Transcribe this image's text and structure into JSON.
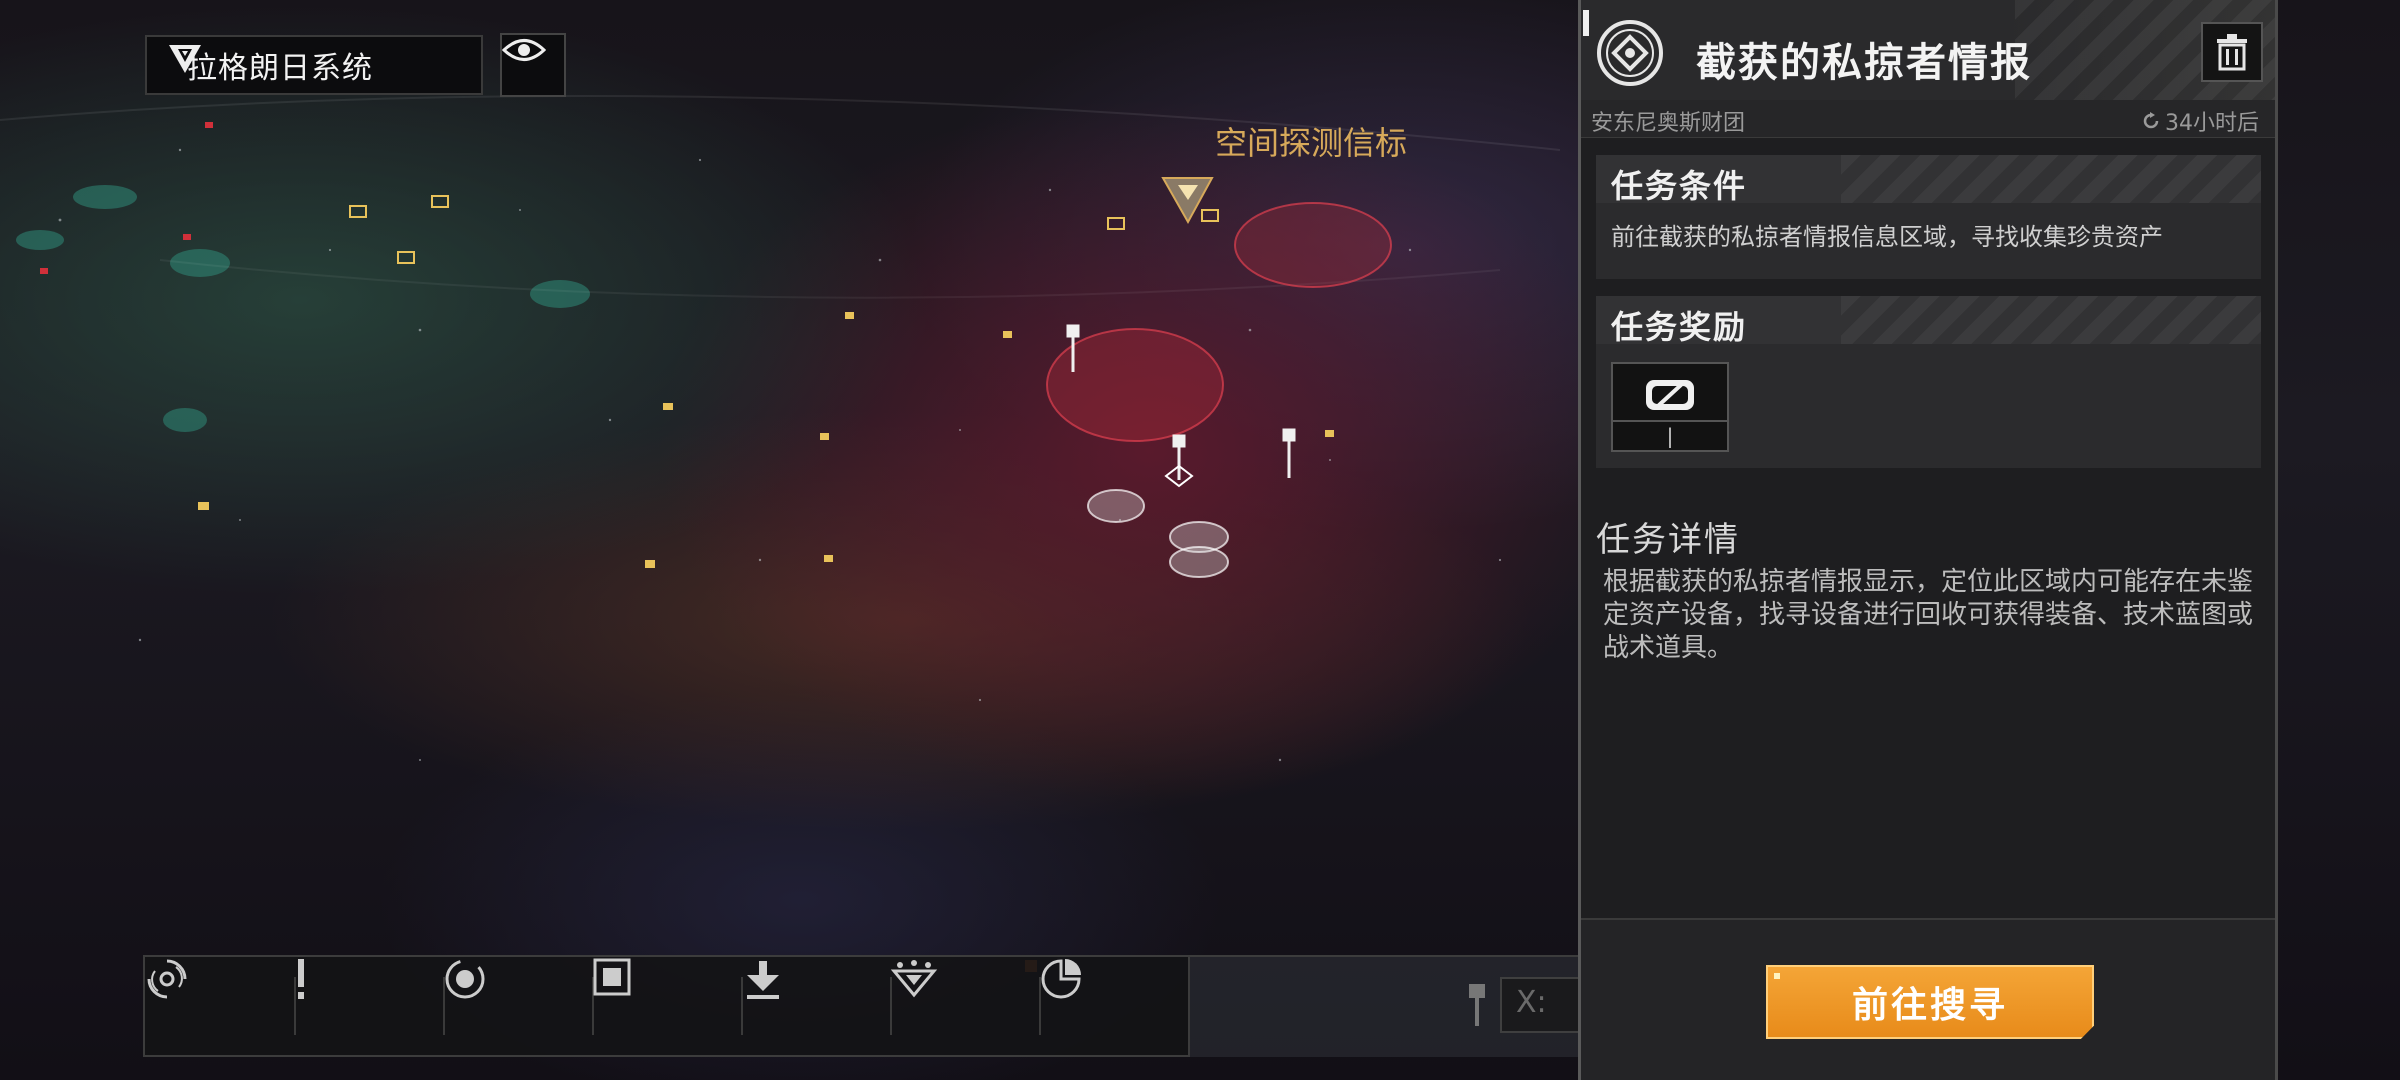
{
  "map": {
    "system_name": "拉格朗日系统",
    "beacon_label": "空间探测信标",
    "coord_placeholder": "X:"
  },
  "toolbar": {
    "items": [
      {
        "icon": "galaxy-spiral-icon"
      },
      {
        "icon": "alert-icon"
      },
      {
        "icon": "orbit-target-icon"
      },
      {
        "icon": "square-frame-icon"
      },
      {
        "icon": "down-arrow-icon"
      },
      {
        "icon": "crown-arrow-icon",
        "badge": true
      },
      {
        "icon": "pie-chart-icon"
      }
    ],
    "badge_color": "#e8772a"
  },
  "mission": {
    "title": "截获的私掠者情报",
    "faction": "安东尼奥斯财团",
    "timer": "34小时后",
    "condition_title": "任务条件",
    "condition_text": "前往截获的私掠者情报信息区域，寻找收集珍贵资产",
    "reward_title": "任务奖励",
    "reward_icon": "blueprint-slash-icon",
    "reward_qty": "|",
    "detail_title": "任务详情",
    "detail_text": "根据截获的私掠者情报显示，定位此区域内可能存在未鉴定资产设备，找寻设备进行回收可获得装备、技术蓝图或战术道具。",
    "action_label": "前往搜寻"
  },
  "colors": {
    "accent": "#f0a030",
    "beacon_text": "#d7a95a",
    "hostile_zone": "#c4303a"
  }
}
